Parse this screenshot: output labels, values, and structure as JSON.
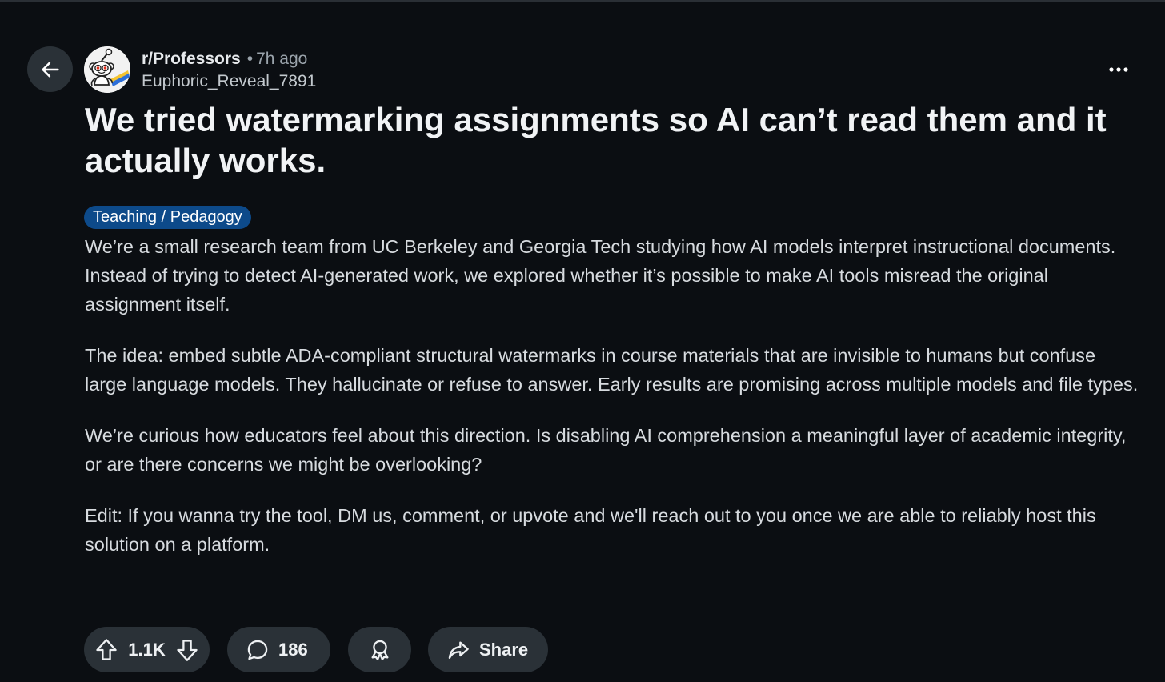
{
  "post": {
    "subreddit": "r/Professors",
    "separator": "•",
    "time_ago": "7h ago",
    "author": "Euphoric_Reveal_7891",
    "title": "We tried watermarking assignments so AI can’t read them and it actually works.",
    "flair": "Teaching / Pedagogy",
    "paragraphs": [
      "We’re a small research team from UC Berkeley and Georgia Tech studying how AI models interpret instructional documents. Instead of trying to detect AI-generated work, we explored whether it’s possible to make AI tools misread the original assignment itself.",
      "The idea: embed subtle ADA-compliant structural watermarks in course materials that are invisible to humans but confuse large language models. They hallucinate or refuse to answer. Early results are promising across multiple models and file types.",
      "We’re curious how educators feel about this direction. Is disabling AI comprehension a meaningful layer of academic integrity, or are there concerns we might be overlooking?",
      "Edit: If you wanna try the tool, DM us, comment, or upvote and we'll reach out to you once we are able to reliably host this solution on a platform."
    ]
  },
  "actions": {
    "vote_count": "1.1K",
    "comment_count": "186",
    "share_label": "Share"
  },
  "icons": {
    "back": "arrow-left-icon",
    "avatar": "reddit-snoo-avatar",
    "more": "more-horizontal-icon",
    "upvote": "upvote-arrow-icon",
    "downvote": "downvote-arrow-icon",
    "comment": "comment-bubble-icon",
    "award": "award-icon",
    "share": "share-arrow-icon"
  },
  "colors": {
    "background": "#0b0e12",
    "button_bg": "#2a3137",
    "flair_bg": "#0d4a8a",
    "text_primary": "#f1f3f5",
    "text_muted": "#9aa3ab"
  }
}
